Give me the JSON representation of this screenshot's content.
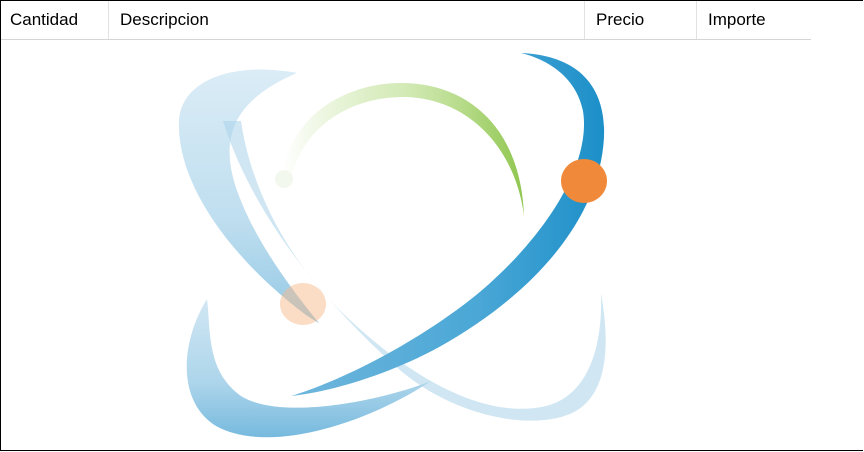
{
  "columns": [
    {
      "label": "Cantidad"
    },
    {
      "label": "Descripcion"
    },
    {
      "label": "Precio"
    },
    {
      "label": "Importe"
    }
  ],
  "watermark": {
    "icon": "atom-logo-icon",
    "colors": {
      "blue": "#1c8fc8",
      "light_blue": "#a9d3ea",
      "green": "#9fd15f",
      "orange": "#f08a3a"
    }
  }
}
